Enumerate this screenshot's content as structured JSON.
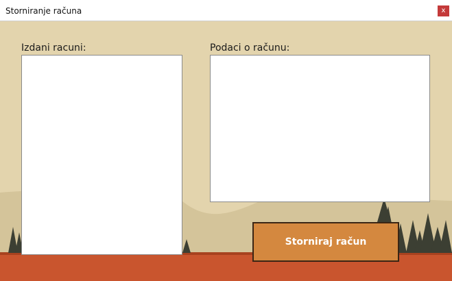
{
  "window": {
    "title": "Storniranje računa",
    "close_label": "x"
  },
  "issued_invoices": {
    "label": "Izdani racuni:",
    "items": []
  },
  "invoice_details": {
    "label": "Podaci o računu:",
    "content": ""
  },
  "actions": {
    "storno_label": "Storniraj račun"
  },
  "colors": {
    "background": "#e3d4ad",
    "ground": "#c9552e",
    "accent_button": "#d4883f",
    "close_button": "#c43a3a"
  }
}
